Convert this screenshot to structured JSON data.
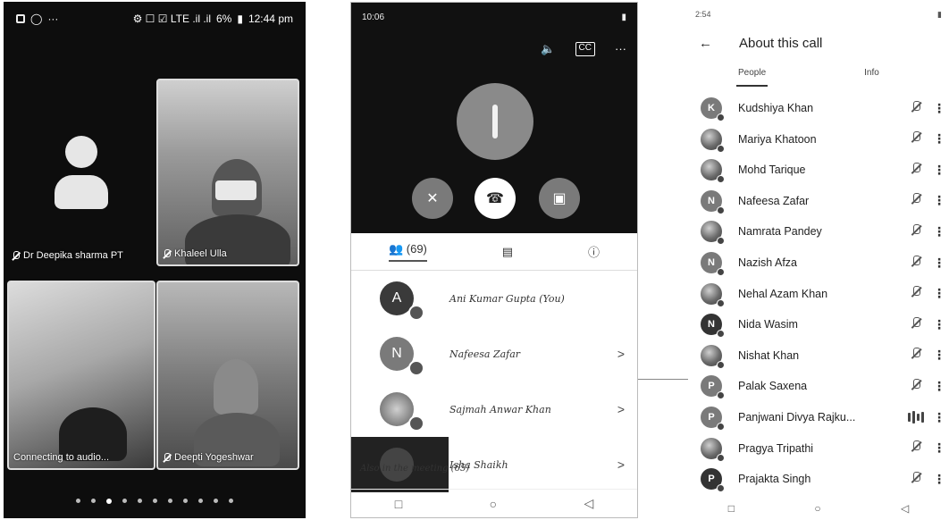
{
  "phone1": {
    "status_time": "12:44 pm",
    "status_battery": "6%",
    "status_icons": "⚙ ☐ ☑ LTE .il .il",
    "tiles": [
      {
        "name": "Dr Deepika sharma PT"
      },
      {
        "name": "Khaleel Ulla"
      },
      {
        "name": "Connecting to audio..."
      },
      {
        "name": "Deepti Yogeshwar"
      }
    ],
    "page_dots": 11,
    "active_dot": 2
  },
  "phone2": {
    "status_time": "10:06",
    "cc_label": "CC",
    "participants_count": "(69)",
    "participants": [
      {
        "initial": "A",
        "name": "Ani Kumar Gupta (You)",
        "chevron": ""
      },
      {
        "initial": "N",
        "name": "Nafeesa Zafar",
        "chevron": ">"
      },
      {
        "initial": "",
        "name": "Sajmah Anwar Khan",
        "chevron": ">"
      },
      {
        "initial": "",
        "name": "Isha Shaikh",
        "chevron": ">"
      }
    ],
    "also_in_meeting": "Also in the meeting (65)"
  },
  "phone3": {
    "status_time": "2:54",
    "title": "About this call",
    "tabs": [
      "People",
      "Info"
    ],
    "people": [
      {
        "initial": "K",
        "name": "Kudshiya Khan",
        "style": "letter",
        "audio": "muted"
      },
      {
        "initial": "",
        "name": "Mariya Khatoon",
        "style": "photo",
        "audio": "muted"
      },
      {
        "initial": "",
        "name": "Mohd Tarique",
        "style": "photo",
        "audio": "muted"
      },
      {
        "initial": "N",
        "name": "Nafeesa Zafar",
        "style": "letter",
        "audio": "muted"
      },
      {
        "initial": "",
        "name": "Namrata Pandey",
        "style": "photo",
        "audio": "muted"
      },
      {
        "initial": "N",
        "name": "Nazish Afza",
        "style": "letter",
        "audio": "muted"
      },
      {
        "initial": "",
        "name": "Nehal Azam Khan",
        "style": "photo",
        "audio": "muted"
      },
      {
        "initial": "N",
        "name": "Nida Wasim",
        "style": "dark",
        "audio": "muted"
      },
      {
        "initial": "",
        "name": "Nishat Khan",
        "style": "photo",
        "audio": "muted"
      },
      {
        "initial": "P",
        "name": "Palak Saxena",
        "style": "letter",
        "audio": "muted"
      },
      {
        "initial": "P",
        "name": "Panjwani Divya Rajku...",
        "style": "letter",
        "audio": "speaking"
      },
      {
        "initial": "",
        "name": "Pragya Tripathi",
        "style": "photo",
        "audio": "muted"
      },
      {
        "initial": "P",
        "name": "Prajakta Singh",
        "style": "dark",
        "audio": "muted"
      }
    ]
  },
  "nav_icons": [
    "square-icon",
    "circle-icon",
    "back-triangle-icon"
  ]
}
